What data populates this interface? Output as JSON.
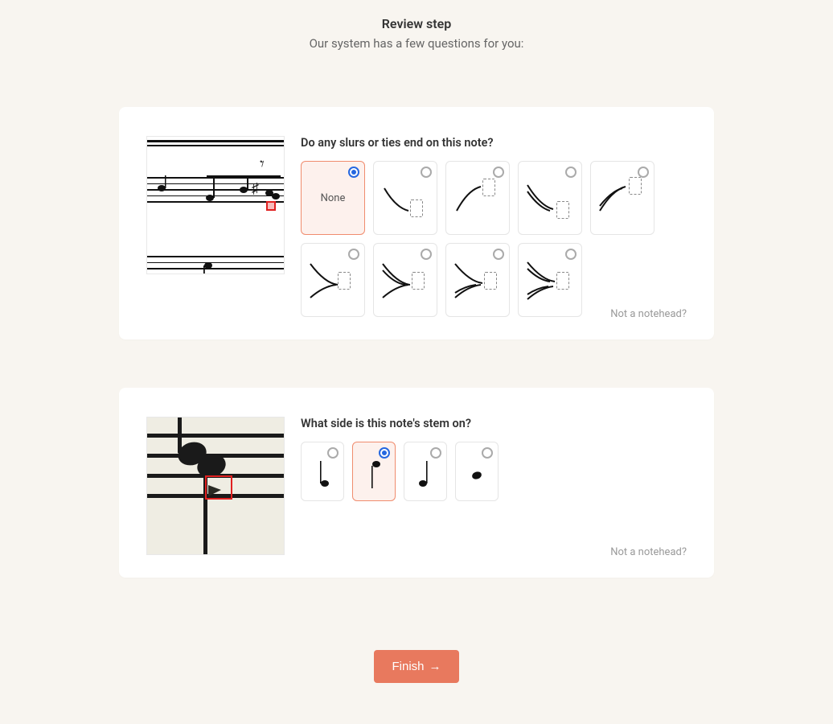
{
  "header": {
    "title": "Review step",
    "subtitle": "Our system has a few questions for you:"
  },
  "questions": {
    "q1": {
      "prompt": "Do any slurs or ties end on this note?",
      "none_label": "None",
      "not_notehead": "Not a notehead?"
    },
    "q2": {
      "prompt": "What side is this note's stem on?",
      "not_notehead": "Not a notehead?"
    }
  },
  "footer": {
    "finish_label": "Finish",
    "finish_arrow": "→"
  },
  "colors": {
    "accent": "#e8795e",
    "selected_border": "#f08c6e",
    "selected_bg": "#fdf1ed",
    "radio_selected": "#2567e0"
  }
}
